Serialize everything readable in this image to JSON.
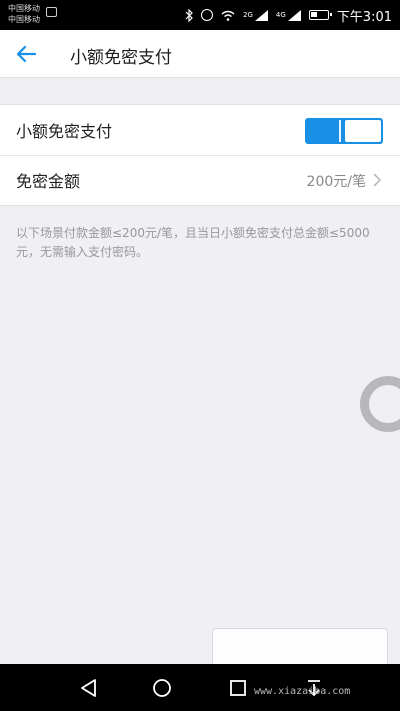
{
  "status_bar": {
    "carrier_line1": "中国移动",
    "carrier_line2": "中国移动",
    "network_label_1": "2G",
    "network_label_2": "4G",
    "time": "下午3:01"
  },
  "header": {
    "title": "小额免密支付"
  },
  "settings": {
    "toggle_row": {
      "label": "小额免密支付",
      "enabled": true
    },
    "amount_row": {
      "label": "免密金额",
      "value": "200元/笔"
    }
  },
  "description": "以下场景付款金额≤200元/笔，且当日小额免密支付总金额≤5000元，无需输入支付密码。",
  "watermark": "www.xiazaiba.com",
  "colors": {
    "accent": "#1a8fe6",
    "background": "#efeff4"
  },
  "icons": {
    "back": "arrow-left-icon",
    "chevron": "chevron-right-icon",
    "nav_back": "triangle-back-icon",
    "nav_home": "circle-home-icon",
    "nav_recent": "square-recent-icon",
    "nav_down": "download-arrow-icon"
  }
}
